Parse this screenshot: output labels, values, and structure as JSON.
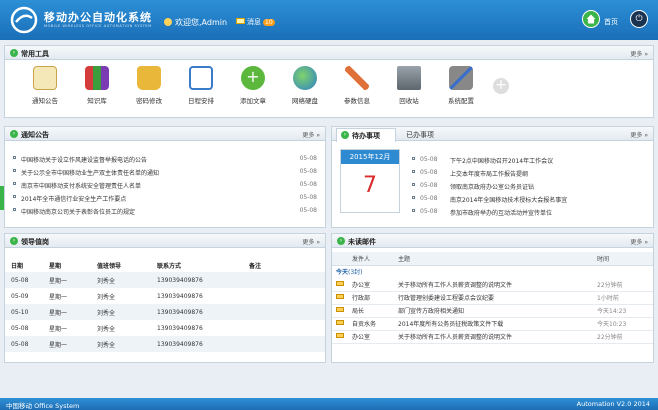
{
  "header": {
    "title": "移动办公自动化系统",
    "subtitle": "MOBILE WIRELESS OFFICE AUTOMATION SYSTEM",
    "welcome": "欢迎您,Admin",
    "message_label": "消息",
    "message_count": "10",
    "home_label": "首页"
  },
  "tools_panel": {
    "title": "常用工具",
    "more": "更多",
    "items": [
      {
        "label": "通知公告",
        "icon": "notice-icon"
      },
      {
        "label": "知识库",
        "icon": "books-icon"
      },
      {
        "label": "密码修改",
        "icon": "lock-icon"
      },
      {
        "label": "日程安排",
        "icon": "calendar-icon"
      },
      {
        "label": "添加文章",
        "icon": "add-icon"
      },
      {
        "label": "网络硬盘",
        "icon": "globe-icon"
      },
      {
        "label": "参数信息",
        "icon": "tools-icon"
      },
      {
        "label": "回收站",
        "icon": "trash-icon"
      },
      {
        "label": "系统配置",
        "icon": "config-icon"
      }
    ]
  },
  "notice_panel": {
    "title": "通知公告",
    "more": "更多",
    "items": [
      {
        "text": "中国移动关于设立作风建设监督举报电话的公告",
        "date": "05-08"
      },
      {
        "text": "关于公示全市中国移动业生产双主体责任名单的通知",
        "date": "05-08"
      },
      {
        "text": "南京市中国移动支付系统安全管理责任人名单",
        "date": "05-08"
      },
      {
        "text": "2014年全市通信行业安全生产工作要点",
        "date": "05-08"
      },
      {
        "text": "中国移动南京公司关于表彰各位员工的规定",
        "date": "05-08"
      }
    ]
  },
  "todo_panel": {
    "tab_active": "待办事项",
    "tab_other": "已办事项",
    "more": "更多",
    "calendar_month": "2015年12月",
    "calendar_day": "7",
    "items": [
      {
        "date": "05-08",
        "text": "下午2点中国移动召开2014年工作会议"
      },
      {
        "date": "05-08",
        "text": "上交本年度市局工作报告提纲"
      },
      {
        "date": "05-08",
        "text": "领取南京政府办公室公务员证钻"
      },
      {
        "date": "05-08",
        "text": "南京2014年全国移动技术授标大会报名事宜"
      },
      {
        "date": "05-08",
        "text": "参加市政府举办的互动活动并宣传单位"
      }
    ]
  },
  "duty_panel": {
    "title": "领导值岗",
    "more": "更多",
    "columns": [
      "日期",
      "星期",
      "值班领导",
      "联系方式",
      "备注"
    ],
    "rows": [
      [
        "05-08",
        "星期一",
        "刘秀全",
        "139039409876",
        ""
      ],
      [
        "05-09",
        "星期一",
        "刘秀全",
        "139039409876",
        ""
      ],
      [
        "05-10",
        "星期一",
        "刘秀全",
        "139039409876",
        ""
      ],
      [
        "05-08",
        "星期一",
        "刘秀全",
        "139039409876",
        ""
      ],
      [
        "05-08",
        "星期一",
        "刘秀全",
        "139039409876",
        ""
      ]
    ]
  },
  "mail_panel": {
    "title": "未读邮件",
    "more": "更多",
    "columns": [
      "发件人",
      "主题",
      "时间"
    ],
    "group_label": "今天",
    "group_count": "(3封)",
    "rows": [
      {
        "sender": "办公室",
        "subject": "关于移动所有工作人员薪资调整的说明文件",
        "time": "22分钟前"
      },
      {
        "sender": "行政部",
        "subject": "行政管理创委建设工程要点会议纪要",
        "time": "1小时前"
      },
      {
        "sender": "局长",
        "subject": "部门宣传方政府相关通知",
        "time": "今天14:23"
      },
      {
        "sender": "自贡水务",
        "subject": "2014年度所有公务员征税政策文件下载",
        "time": "今天10:23"
      },
      {
        "sender": "办公室",
        "subject": "关于移动所有工作人员薪资调整的说明文件",
        "time": "22分钟前"
      }
    ]
  },
  "footer": {
    "left": "中国移动  Office System",
    "right": "Automation V2.0 2014"
  }
}
